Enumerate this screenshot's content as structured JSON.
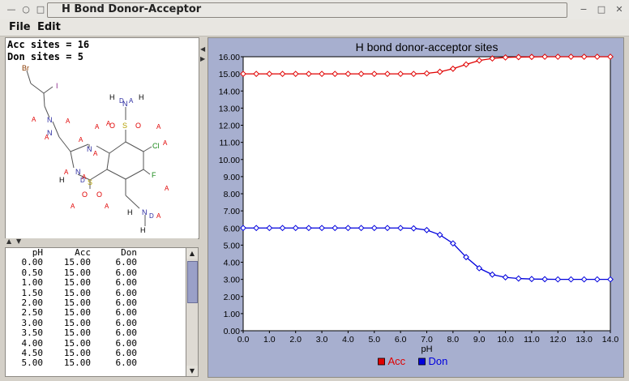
{
  "window": {
    "title": "H Bond Donor-Acceptor"
  },
  "menu": {
    "file": "File",
    "edit": "Edit"
  },
  "molecule": {
    "acc_sites_text": "Acc sites = 16",
    "don_sites_text": "Don sites = 5",
    "atoms": [
      "Br",
      "I",
      "N",
      "N",
      "N",
      "N",
      "Cl",
      "F",
      "S",
      "O",
      "O",
      "S",
      "O",
      "O",
      "N",
      "H",
      "H",
      "N",
      "H",
      "H",
      "H"
    ],
    "site_marks": [
      "A",
      "D"
    ]
  },
  "table": {
    "headers": [
      "pH",
      "Acc",
      "Don"
    ],
    "rows": [
      [
        "0.00",
        "15.00",
        "6.00"
      ],
      [
        "0.50",
        "15.00",
        "6.00"
      ],
      [
        "1.00",
        "15.00",
        "6.00"
      ],
      [
        "1.50",
        "15.00",
        "6.00"
      ],
      [
        "2.00",
        "15.00",
        "6.00"
      ],
      [
        "2.50",
        "15.00",
        "6.00"
      ],
      [
        "3.00",
        "15.00",
        "6.00"
      ],
      [
        "3.50",
        "15.00",
        "6.00"
      ],
      [
        "4.00",
        "15.00",
        "6.00"
      ],
      [
        "4.50",
        "15.00",
        "6.00"
      ],
      [
        "5.00",
        "15.00",
        "6.00"
      ]
    ]
  },
  "chart_data": {
    "type": "line",
    "title": "H bond donor-acceptor sites",
    "xlabel": "pH",
    "ylabel": "",
    "xlim": [
      0,
      14
    ],
    "ylim": [
      0,
      16
    ],
    "x_ticks": [
      "0.0",
      "1.0",
      "2.0",
      "3.0",
      "4.0",
      "5.0",
      "6.0",
      "7.0",
      "8.0",
      "9.0",
      "10.0",
      "11.0",
      "12.0",
      "13.0",
      "14.0"
    ],
    "y_ticks": [
      "0.00",
      "1.00",
      "2.00",
      "3.00",
      "4.00",
      "5.00",
      "6.00",
      "7.00",
      "8.00",
      "9.00",
      "10.00",
      "11.00",
      "12.00",
      "13.00",
      "14.00",
      "15.00",
      "16.00"
    ],
    "legend_position": "bottom",
    "x": [
      0,
      0.5,
      1,
      1.5,
      2,
      2.5,
      3,
      3.5,
      4,
      4.5,
      5,
      5.5,
      6,
      6.5,
      7,
      7.5,
      8,
      8.5,
      9,
      9.5,
      10,
      10.5,
      11,
      11.5,
      12,
      12.5,
      13,
      13.5,
      14
    ],
    "series": [
      {
        "name": "Acc",
        "color": "#e00000",
        "values": [
          15,
          15,
          15,
          15,
          15,
          15,
          15,
          15,
          15,
          15,
          15,
          15,
          15,
          15,
          15.03,
          15.12,
          15.3,
          15.55,
          15.78,
          15.9,
          15.96,
          15.98,
          15.99,
          16,
          16,
          16,
          16,
          16,
          16
        ]
      },
      {
        "name": "Don",
        "color": "#0000dd",
        "values": [
          6,
          6,
          6,
          6,
          6,
          6,
          6,
          6,
          6,
          6,
          6,
          6,
          6,
          5.98,
          5.88,
          5.6,
          5.1,
          4.3,
          3.65,
          3.28,
          3.12,
          3.05,
          3.02,
          3.01,
          3,
          3,
          3,
          3,
          3
        ]
      }
    ]
  }
}
